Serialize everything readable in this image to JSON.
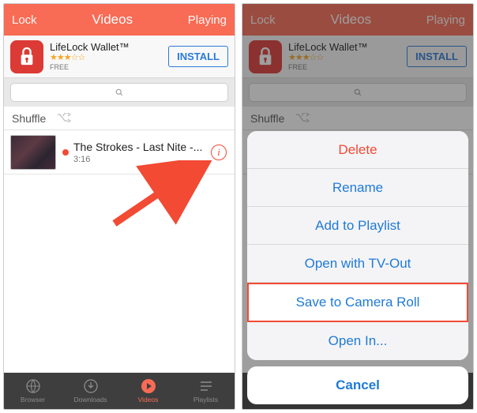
{
  "colors": {
    "accent": "#f86b55",
    "link_blue": "#1f7ad6",
    "destructive": "#f24a33"
  },
  "nav": {
    "left": "Lock",
    "title": "Videos",
    "right": "Playing"
  },
  "ad": {
    "title": "LifeLock Wallet™",
    "stars_glyph": "★★★☆☆",
    "free_label": "FREE",
    "install_label": "INSTALL"
  },
  "shuffle": {
    "label": "Shuffle"
  },
  "videos": [
    {
      "title": "The Strokes - Last Nite -...",
      "duration": "3:16"
    }
  ],
  "tabs": [
    {
      "label": "Browser"
    },
    {
      "label": "Downloads"
    },
    {
      "label": "Videos",
      "active": true
    },
    {
      "label": "Playlists"
    }
  ],
  "action_sheet": {
    "items": [
      {
        "label": "Delete",
        "kind": "destructive"
      },
      {
        "label": "Rename",
        "kind": "normal"
      },
      {
        "label": "Add to Playlist",
        "kind": "normal"
      },
      {
        "label": "Open with TV-Out",
        "kind": "normal"
      },
      {
        "label": "Save to Camera Roll",
        "kind": "highlight"
      },
      {
        "label": "Open In...",
        "kind": "normal"
      }
    ],
    "cancel": "Cancel"
  }
}
